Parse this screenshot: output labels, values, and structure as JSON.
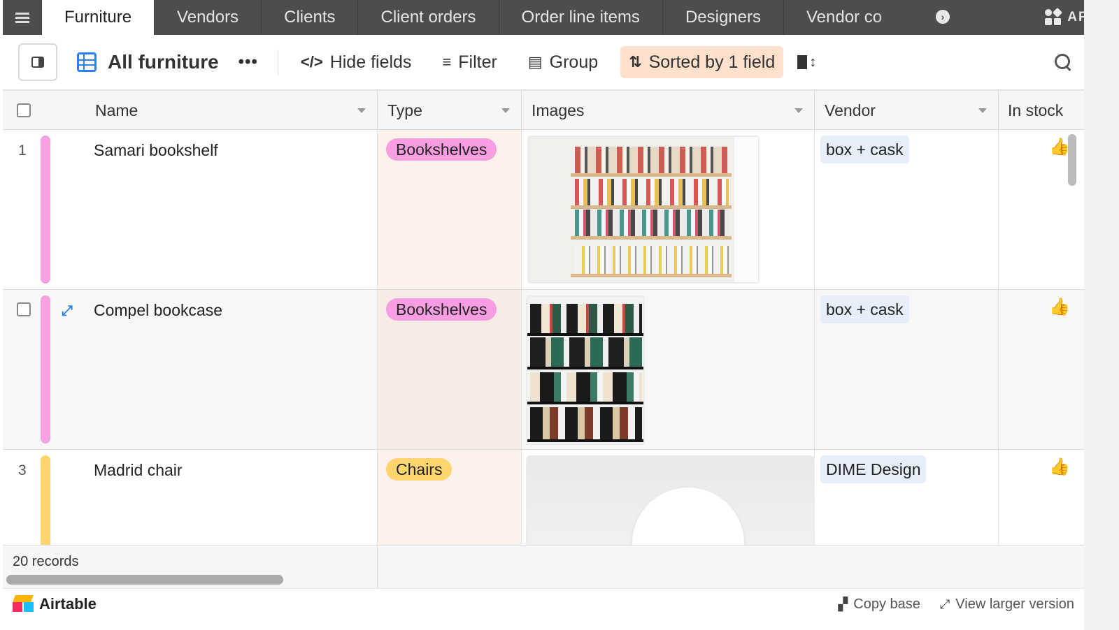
{
  "tabs": [
    {
      "label": "Furniture",
      "active": true
    },
    {
      "label": "Vendors"
    },
    {
      "label": "Clients"
    },
    {
      "label": "Client orders"
    },
    {
      "label": "Order line items"
    },
    {
      "label": "Designers"
    },
    {
      "label": "Vendor co"
    }
  ],
  "apps_label": "APPS",
  "toolbar": {
    "view_name": "All furniture",
    "more": "•••",
    "hide_fields": "Hide fields",
    "filter": "Filter",
    "group": "Group",
    "sorted": "Sorted by 1 field"
  },
  "columns": {
    "name": "Name",
    "type": "Type",
    "images": "Images",
    "vendor": "Vendor",
    "in_stock": "In stock"
  },
  "rows": [
    {
      "num": "1",
      "name": "Samari bookshelf",
      "type": "Bookshelves",
      "vendor": "box + cask",
      "in_stock": true,
      "color": "#f7a1e0",
      "type_color": "#f99de2"
    },
    {
      "num": "",
      "name": "Compel bookcase",
      "type": "Bookshelves",
      "vendor": "box + cask",
      "in_stock": true,
      "color": "#f7a1e0",
      "type_color": "#f99de2"
    },
    {
      "num": "3",
      "name": "Madrid chair",
      "type": "Chairs",
      "vendor": "DIME Design",
      "in_stock": true,
      "color": "#ffd66e",
      "type_color": "#ffd66e"
    }
  ],
  "icons": {
    "in_stock": "thumbs-up-icon"
  },
  "footer": {
    "records": "20 records",
    "brand": "Airtable",
    "copy_base": "Copy base",
    "view_larger": "View larger version"
  }
}
